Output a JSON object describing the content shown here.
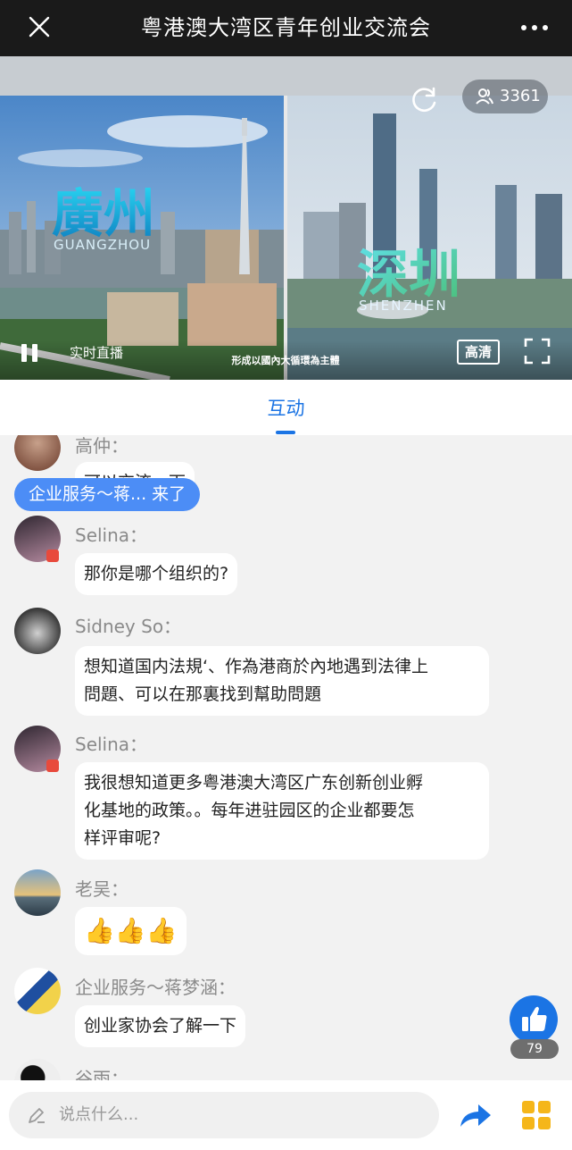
{
  "header": {
    "title": "粤港澳大湾区青年创业交流会"
  },
  "video": {
    "viewer_count": "3361",
    "live_label": "实时直播",
    "subtitle": "形成以國內大循環為主體",
    "hd_label": "高清",
    "left_city_text": "廣州",
    "left_city_roman": "GUANGZHOU",
    "right_city_text": "深圳",
    "right_city_roman": "SHENZHEN"
  },
  "tabs": {
    "active": "互动"
  },
  "chat": {
    "join_notice": "企业服务～蒋... 来了",
    "messages": [
      {
        "user": "高仲：",
        "text": "可以交流一下"
      },
      {
        "user": "Selina：",
        "text": "那你是哪个组织的?"
      },
      {
        "user": "Sidney So：",
        "text_lines": [
          "想知道国内法規‘、作為港商於內地遇到法律上",
          "問題、可以在那裏找到幫助問題"
        ]
      },
      {
        "user": "Selina：",
        "text_lines": [
          "我很想知道更多粤港澳大湾区广东创新创业孵",
          "化基地的政策。。每年进驻园区的企业都要怎",
          "样评审呢?"
        ]
      },
      {
        "user": "老吴：",
        "text": "👍👍👍"
      },
      {
        "user": "企业服务～蒋梦涵：",
        "text": "创业家协会了解一下"
      },
      {
        "user": "谷雨："
      }
    ]
  },
  "like": {
    "count": "79"
  },
  "input": {
    "placeholder": "说点什么..."
  },
  "colors": {
    "accent": "#1b74e4",
    "join_pill": "#4c8df6",
    "topbar": "#1a1a1a"
  },
  "icons": [
    "close-icon",
    "more-icon",
    "refresh-icon",
    "viewers-icon",
    "pause-icon",
    "fullscreen-icon",
    "thumbs-up-icon",
    "pen-icon",
    "share-icon",
    "apps-icon"
  ]
}
